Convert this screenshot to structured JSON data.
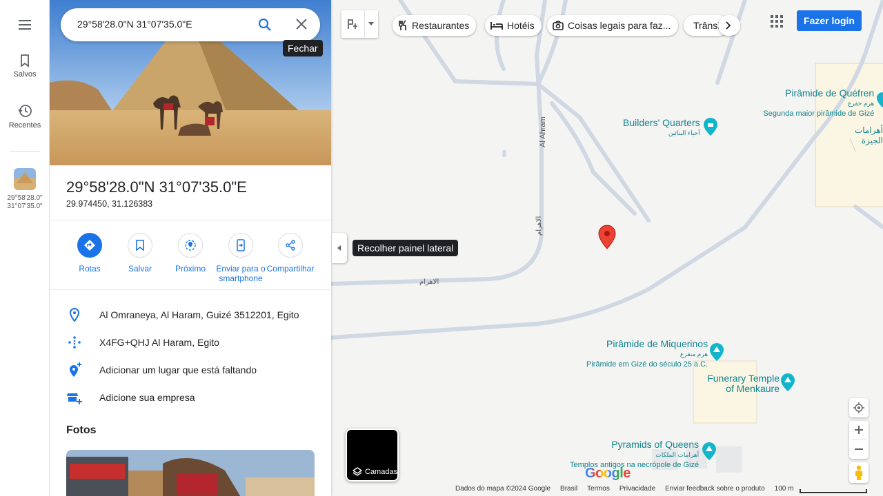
{
  "rail": {
    "menu_icon": "hamburger-icon",
    "saved_label": "Salvos",
    "recent_label": "Recentes",
    "recent_place_line1": "29°58'28.0\"",
    "recent_place_line2": "31°07'35.0\""
  },
  "search": {
    "query": "29°58'28.0\"N 31°07'35.0\"E",
    "close_tooltip": "Fechar"
  },
  "place": {
    "title": "29°58'28.0\"N 31°07'35.0\"E",
    "coords": "29.974450, 31.126383"
  },
  "actions": [
    {
      "label": "Rotas",
      "icon": "directions-icon"
    },
    {
      "label": "Salvar",
      "icon": "bookmark-icon"
    },
    {
      "label": "Próximo",
      "icon": "nearby-icon"
    },
    {
      "label": "Enviar para o smartphone",
      "icon": "send-to-phone-icon"
    },
    {
      "label": "Compartilhar",
      "icon": "share-icon"
    }
  ],
  "info": {
    "address": "Al Omraneya, Al Haram, Guizé 3512201, Egito",
    "plus_code": "X4FG+QHJ Al Haram, Egito",
    "add_place": "Adicionar um lugar que está faltando",
    "add_business": "Adicione sua empresa"
  },
  "photos_heading": "Fotos",
  "map": {
    "chips": [
      "Restaurantes",
      "Hotéis",
      "Coisas legais para faz...",
      "Trânsito"
    ],
    "login": "Fazer login",
    "collapse_tooltip": "Recolher painel lateral",
    "layers_label": "Camadas",
    "roads": {
      "al_ahram_latin": "Al Ahram",
      "al_ahram_arabic": "الاهرام"
    },
    "pois": {
      "khafre": {
        "name": "Pirâmide de Quéfren",
        "arabic": "هرم خفرع",
        "sub": "Segunda maior pirâmide de Gizé"
      },
      "giza_pyramids_arabic": "أهرامات الجيزة",
      "builders": {
        "name": "Builders' Quarters",
        "arabic": "أحياء البنائين"
      },
      "menkaure": {
        "name": "Pirâmide de Miquerinos",
        "arabic": "هرم منقرع",
        "sub": "Pirâmide em Gizé do século 25 a.C."
      },
      "temple": {
        "name": "Funerary Temple of Menkaure"
      },
      "queens": {
        "name": "Pyramids of Queens",
        "arabic": "أهرامات الملكات",
        "sub": "Templos antigos na necrópole de Gizé"
      }
    },
    "google_logo": "Google",
    "footer": [
      "Dados do mapa ©2024 Google",
      "Brasil",
      "Termos",
      "Privacidade",
      "Enviar feedback sobre o produto"
    ],
    "scale": "100 m"
  },
  "colors": {
    "accent": "#1a73e8",
    "poi": "#11838f",
    "pin": "#ea4335",
    "map_bg": "#f4f4f3"
  }
}
